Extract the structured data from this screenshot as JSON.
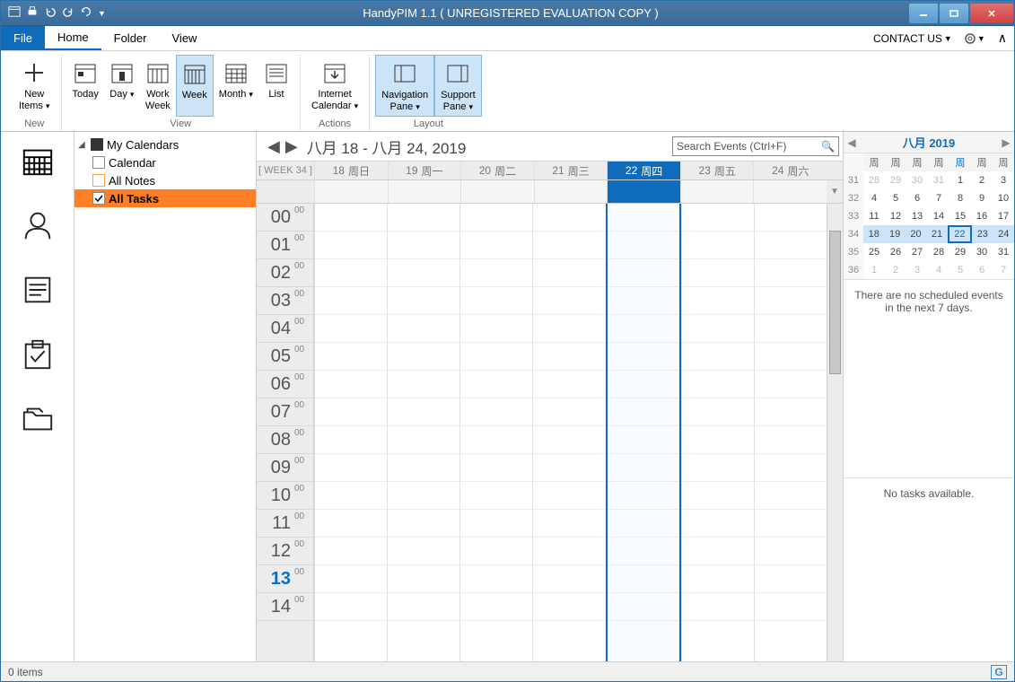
{
  "titlebar": {
    "title": "HandyPIM 1.1 ( UNREGISTERED EVALUATION COPY )"
  },
  "menu": {
    "file": "File",
    "home": "Home",
    "folder": "Folder",
    "view": "View",
    "contact": "CONTACT US"
  },
  "ribbon": {
    "new_items": "New\nItems",
    "new_group": "New",
    "today": "Today",
    "day": "Day",
    "work_week": "Work\nWeek",
    "week": "Week",
    "month": "Month",
    "list": "List",
    "view_group": "View",
    "internet_calendar": "Internet\nCalendar",
    "actions_group": "Actions",
    "nav_pane": "Navigation\nPane",
    "support_pane": "Support\nPane",
    "layout_group": "Layout"
  },
  "tree": {
    "my_calendars": "My Calendars",
    "calendar": "Calendar",
    "all_notes": "All Notes",
    "all_tasks": "All Tasks"
  },
  "calendar": {
    "range": "八月 18 - 八月 24, 2019",
    "search_placeholder": "Search Events (Ctrl+F)",
    "week_label": "[ WEEK 34 ]",
    "days": [
      {
        "num": "18",
        "dow": "周日"
      },
      {
        "num": "19",
        "dow": "周一"
      },
      {
        "num": "20",
        "dow": "周二"
      },
      {
        "num": "21",
        "dow": "周三"
      },
      {
        "num": "22",
        "dow": "周四"
      },
      {
        "num": "23",
        "dow": "周五"
      },
      {
        "num": "24",
        "dow": "周六"
      }
    ],
    "today_index": 4,
    "hours": [
      "00",
      "01",
      "02",
      "03",
      "04",
      "05",
      "06",
      "07",
      "08",
      "09",
      "10",
      "11",
      "12",
      "13",
      "14"
    ],
    "current_hour": "13",
    "minute_label": "00"
  },
  "mini": {
    "title": "八月 2019",
    "dow": [
      "周",
      "周",
      "周",
      "周",
      "周",
      "周",
      "周"
    ],
    "today_dow_index": 4,
    "rows": [
      {
        "wk": "31",
        "cells": [
          {
            "v": "28",
            "o": true
          },
          {
            "v": "29",
            "o": true
          },
          {
            "v": "30",
            "o": true
          },
          {
            "v": "31",
            "o": true
          },
          {
            "v": "1"
          },
          {
            "v": "2"
          },
          {
            "v": "3"
          }
        ]
      },
      {
        "wk": "32",
        "cells": [
          {
            "v": "4"
          },
          {
            "v": "5"
          },
          {
            "v": "6"
          },
          {
            "v": "7"
          },
          {
            "v": "8"
          },
          {
            "v": "9"
          },
          {
            "v": "10"
          }
        ]
      },
      {
        "wk": "33",
        "cells": [
          {
            "v": "11"
          },
          {
            "v": "12"
          },
          {
            "v": "13"
          },
          {
            "v": "14"
          },
          {
            "v": "15"
          },
          {
            "v": "16"
          },
          {
            "v": "17"
          }
        ]
      },
      {
        "wk": "34",
        "cells": [
          {
            "v": "18",
            "w": true
          },
          {
            "v": "19",
            "w": true
          },
          {
            "v": "20",
            "w": true
          },
          {
            "v": "21",
            "w": true
          },
          {
            "v": "22",
            "w": true,
            "t": true
          },
          {
            "v": "23",
            "w": true
          },
          {
            "v": "24",
            "w": true
          }
        ]
      },
      {
        "wk": "35",
        "cells": [
          {
            "v": "25"
          },
          {
            "v": "26"
          },
          {
            "v": "27"
          },
          {
            "v": "28"
          },
          {
            "v": "29"
          },
          {
            "v": "30"
          },
          {
            "v": "31"
          }
        ]
      },
      {
        "wk": "36",
        "cells": [
          {
            "v": "1",
            "o": true
          },
          {
            "v": "2",
            "o": true
          },
          {
            "v": "3",
            "o": true
          },
          {
            "v": "4",
            "o": true
          },
          {
            "v": "5",
            "o": true
          },
          {
            "v": "6",
            "o": true
          },
          {
            "v": "7",
            "o": true
          }
        ]
      }
    ],
    "no_events": "There are no scheduled events in the next 7 days.",
    "no_tasks": "No tasks available."
  },
  "status": {
    "items": "0 items"
  }
}
